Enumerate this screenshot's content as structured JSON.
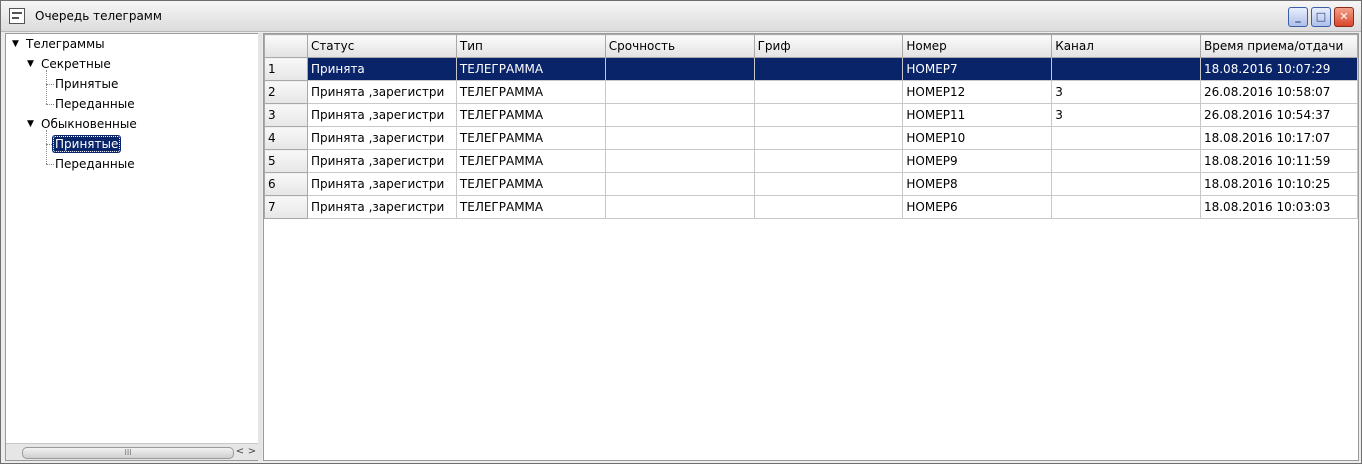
{
  "window": {
    "title": "Очередь телеграмм",
    "buttons": {
      "minimize": "_",
      "maximize": "□",
      "close": "✕"
    }
  },
  "tree": {
    "root": "Телеграммы",
    "secret": {
      "label": "Секретные",
      "received": "Принятые",
      "sent": "Переданные"
    },
    "ordinary": {
      "label": "Обыкновенные",
      "received": "Принятые",
      "sent": "Переданные"
    },
    "selected": "ordinary.received",
    "scrollbar_grip": "III",
    "scroll_left": "<",
    "scroll_right": ">"
  },
  "grid": {
    "columns": [
      "Статус",
      "Тип",
      "Срочность",
      "Гриф",
      "Номер",
      "Канал",
      "Время приема/отдачи"
    ],
    "rows": [
      {
        "n": "1",
        "cells": [
          "Принята",
          "ТЕЛЕГРАММА",
          "",
          "",
          "НОМЕР7",
          "",
          "18.08.2016 10:07:29"
        ]
      },
      {
        "n": "2",
        "cells": [
          "Принята ,зарегистри",
          "ТЕЛЕГРАММА",
          "",
          "",
          "НОМЕР12",
          "3",
          "26.08.2016 10:58:07"
        ]
      },
      {
        "n": "3",
        "cells": [
          "Принята ,зарегистри",
          "ТЕЛЕГРАММА",
          "",
          "",
          "НОМЕР11",
          "3",
          "26.08.2016 10:54:37"
        ]
      },
      {
        "n": "4",
        "cells": [
          "Принята ,зарегистри",
          "ТЕЛЕГРАММА",
          "",
          "",
          "НОМЕР10",
          "",
          "18.08.2016 10:17:07"
        ]
      },
      {
        "n": "5",
        "cells": [
          "Принята ,зарегистри",
          "ТЕЛЕГРАММА",
          "",
          "",
          "НОМЕР9",
          "",
          "18.08.2016 10:11:59"
        ]
      },
      {
        "n": "6",
        "cells": [
          "Принята ,зарегистри",
          "ТЕЛЕГРАММА",
          "",
          "",
          "НОМЕР8",
          "",
          "18.08.2016 10:10:25"
        ]
      },
      {
        "n": "7",
        "cells": [
          "Принята ,зарегистри",
          "ТЕЛЕГРАММА",
          "",
          "",
          "НОМЕР6",
          "",
          "18.08.2016 10:03:03"
        ]
      }
    ],
    "selected_row": "1"
  }
}
